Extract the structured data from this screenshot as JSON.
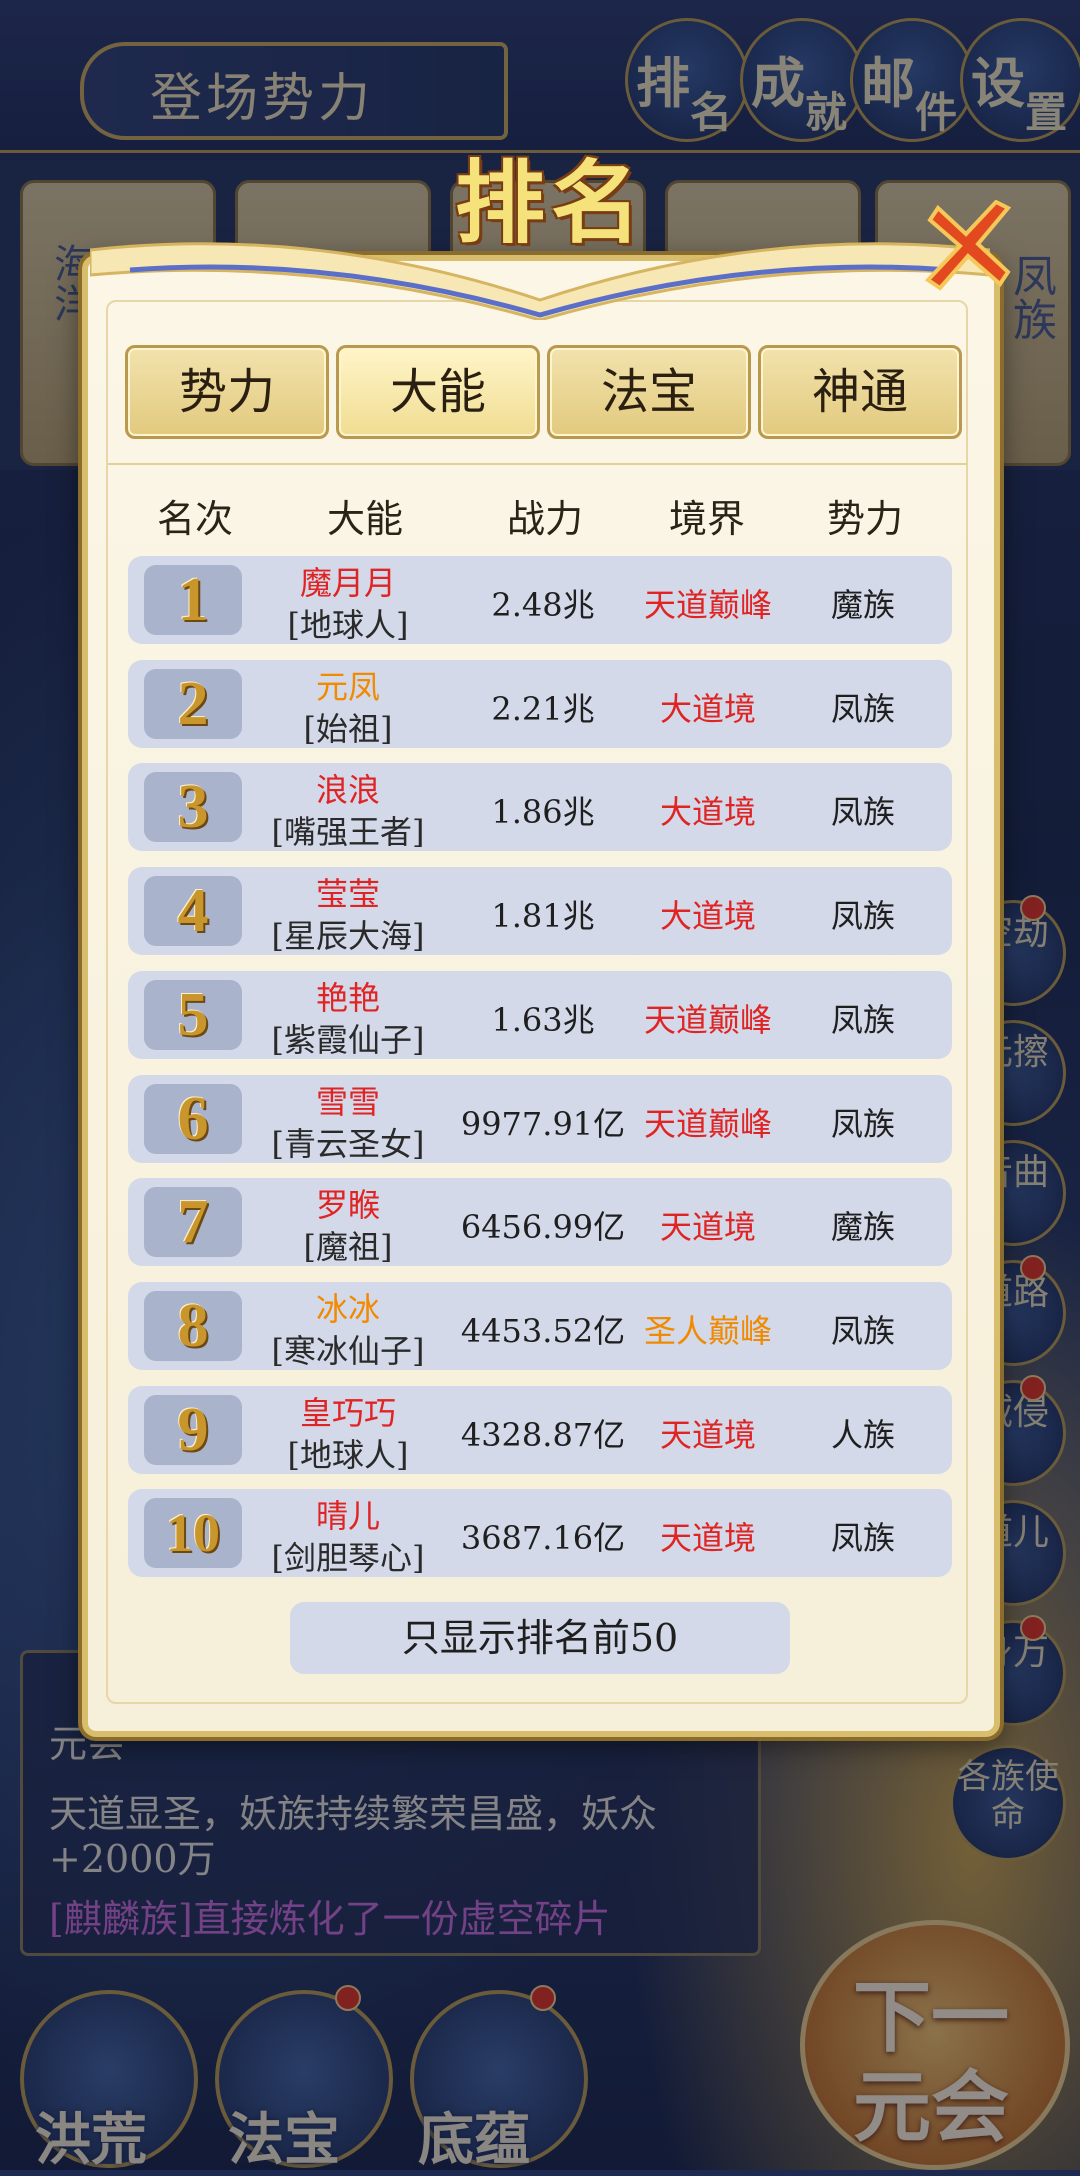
{
  "top_bar": {
    "title": "登场势力",
    "buttons": [
      {
        "main": "排",
        "sub": "名"
      },
      {
        "main": "成",
        "sub": "就"
      },
      {
        "main": "邮",
        "sub": "件"
      },
      {
        "main": "设",
        "sub": "置"
      }
    ]
  },
  "background_cards": [
    "海洋",
    "凤族"
  ],
  "side_buttons": [
    "空劫",
    "元擦",
    "音曲",
    "道路",
    "域侵",
    "道儿",
    "身万",
    "各族使命"
  ],
  "log": {
    "lines": [
      "元会",
      "天道显圣，妖族持续繁荣昌盛，妖众",
      "+2000万"
    ],
    "highlight": "[麒麟族]直接炼化了一份虚空碎片"
  },
  "bottom_nav": {
    "items": [
      "洪荒",
      "法宝",
      "底蕴"
    ],
    "next": [
      "下一",
      "元会"
    ]
  },
  "modal": {
    "title": "排名",
    "tabs": [
      "势力",
      "大能",
      "法宝",
      "神通"
    ],
    "active_tab": "大能",
    "headers": [
      "名次",
      "大能",
      "战力",
      "境界",
      "势力"
    ],
    "rows": [
      {
        "rank": "1",
        "name": "魔月月",
        "title": "[地球人]",
        "power": "2.48兆",
        "realm": "天道巅峰",
        "faction": "魔族",
        "name_color": "red",
        "realm_color": "red"
      },
      {
        "rank": "2",
        "name": "元凤",
        "title": "[始祖]",
        "power": "2.21兆",
        "realm": "大道境",
        "faction": "凤族",
        "name_color": "orange",
        "realm_color": "red"
      },
      {
        "rank": "3",
        "name": "浪浪",
        "title": "[嘴强王者]",
        "power": "1.86兆",
        "realm": "大道境",
        "faction": "凤族",
        "name_color": "red",
        "realm_color": "red"
      },
      {
        "rank": "4",
        "name": "莹莹",
        "title": "[星辰大海]",
        "power": "1.81兆",
        "realm": "大道境",
        "faction": "凤族",
        "name_color": "red",
        "realm_color": "red"
      },
      {
        "rank": "5",
        "name": "艳艳",
        "title": "[紫霞仙子]",
        "power": "1.63兆",
        "realm": "天道巅峰",
        "faction": "凤族",
        "name_color": "red",
        "realm_color": "red"
      },
      {
        "rank": "6",
        "name": "雪雪",
        "title": "[青云圣女]",
        "power": "9977.91亿",
        "realm": "天道巅峰",
        "faction": "凤族",
        "name_color": "red",
        "realm_color": "red"
      },
      {
        "rank": "7",
        "name": "罗睺",
        "title": "[魔祖]",
        "power": "6456.99亿",
        "realm": "天道境",
        "faction": "魔族",
        "name_color": "red",
        "realm_color": "red"
      },
      {
        "rank": "8",
        "name": "冰冰",
        "title": "[寒冰仙子]",
        "power": "4453.52亿",
        "realm": "圣人巅峰",
        "faction": "凤族",
        "name_color": "orange",
        "realm_color": "orange"
      },
      {
        "rank": "9",
        "name": "皇巧巧",
        "title": "[地球人]",
        "power": "4328.87亿",
        "realm": "天道境",
        "faction": "人族",
        "name_color": "red",
        "realm_color": "red"
      },
      {
        "rank": "10",
        "name": "晴儿",
        "title": "[剑胆琴心]",
        "power": "3687.16亿",
        "realm": "天道境",
        "faction": "凤族",
        "name_color": "red",
        "realm_color": "red"
      }
    ],
    "footer": "只显示排名前50"
  }
}
